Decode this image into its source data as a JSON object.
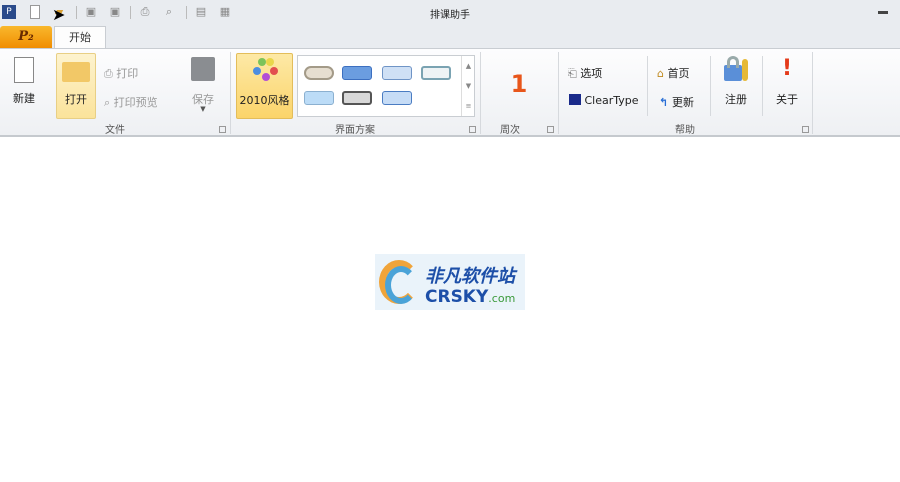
{
  "window": {
    "title": "排课助手",
    "minimize_icon": "minimize-icon"
  },
  "quick_access": [
    "app-icon",
    "new-doc-icon",
    "open-folder-icon",
    "save-icon",
    "save-as-icon",
    "print-icon",
    "print-preview-icon",
    "options-icon",
    "grid-icon"
  ],
  "tabs": {
    "file_tab": "P₂",
    "home": "开始"
  },
  "groups": {
    "file": {
      "label": "文件",
      "new": "新建",
      "open": "打开",
      "print": "打印",
      "print_preview": "打印预览",
      "save": "保存"
    },
    "theme": {
      "label": "界面方案",
      "style2010": "2010风格"
    },
    "week": {
      "label": "周次",
      "value": "1"
    },
    "help": {
      "label": "帮助",
      "options": "选项",
      "cleartype": "ClearType",
      "home": "首页",
      "update": "更新",
      "register": "注册",
      "about": "关于"
    }
  },
  "logo": {
    "cn": "非凡软件站",
    "en": "CRSKY",
    "domain": ".com"
  }
}
